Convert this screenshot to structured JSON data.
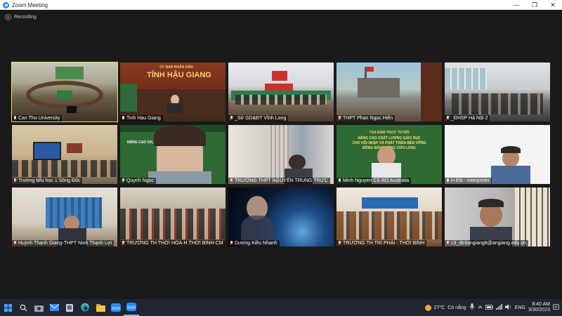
{
  "window": {
    "title": "Zoom Meeting",
    "minimize": "—",
    "restore": "❐",
    "close": "✕"
  },
  "recording": {
    "label": "Recording"
  },
  "tiles": [
    {
      "label": "Can Tho University",
      "muted": false
    },
    {
      "label": "Tinh Hau Giang",
      "muted": false,
      "sign": "TỈNH HẬU GIANG",
      "sign_small": "ỦY BAN NHÂN DÂN"
    },
    {
      "label": "_Sở GD&ĐT Vĩnh Long",
      "muted": true
    },
    {
      "label": "THPT Phan Ngọc Hiển",
      "muted": true
    },
    {
      "label": "_ĐHSP Hà Nội 2",
      "muted": true
    },
    {
      "label": "Trường tiểu học 1 Sông Đốc",
      "muted": true
    },
    {
      "label": "Quynh Ngoc",
      "muted": true,
      "slide": "NÂNG CAO CH..."
    },
    {
      "label": "TRƯỜNG THPT NGUYỄN TRUNG TRỰC",
      "muted": true
    },
    {
      "label": "Minh Nguyen CS RO Australia",
      "muted": false,
      "slide_top": "TỌA ĐÀM TRỰC TUYẾN",
      "slide_main": "NÂNG CAO CHẤT LƯỢNG GIÁO DỤC\nCHO HỘI NHẬP VÀ PHÁT TRIỂN BỀN VỮNG\nĐỒNG BẰNG SÔNG CỬU LONG"
    },
    {
      "label": "H EN - interpreter",
      "muted": false
    },
    {
      "label": "Huỳnh Thanh Giang-THPT Ninh Thạnh Lợi",
      "muted": true
    },
    {
      "label": "TRƯỜNG TH THỚI HÒA-H.THỚI BÌNH-CM",
      "muted": true
    },
    {
      "label": "Dương Kiều Nhanh",
      "muted": true
    },
    {
      "label": "TRƯỜNG TH TRÍ PHẢI - THỚI BÌNH",
      "muted": true
    },
    {
      "label": "c3_dtritangiangtt@angiang.edu.vn",
      "muted": true
    }
  ],
  "taskbar": {
    "weather_temp": "27°C",
    "weather_text": "Có nắng",
    "language": "ENG",
    "time": "8:40 AM",
    "date": "3/30/2023"
  },
  "colors": {
    "active_speaker": "#d9e85a",
    "zoom_blue": "#2d8cff",
    "taskbar": "#1f2630"
  }
}
